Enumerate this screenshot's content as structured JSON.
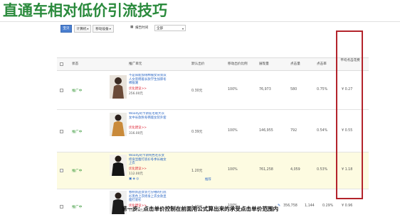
{
  "slide": {
    "title": "直通车相对低价引流技巧",
    "caption": "第一步：点击单价控制在前面用公式算出来的承受点击单价范围内"
  },
  "toolbar": {
    "tabs": [
      {
        "label": "宝贝",
        "active": true
      },
      {
        "label": "计算机",
        "active": false
      },
      {
        "label": "移动设备",
        "active": false
      }
    ],
    "report_label": "报告时间",
    "report_value": "全部"
  },
  "table": {
    "headers": {
      "status": "状态",
      "product": "推广单元",
      "default_bid": "默认出价",
      "mobile_bid": "移动出价比例",
      "impressions": "展现量",
      "clicks": "点击量",
      "ctr": "点击率",
      "avg_cpc": "平均点击花费"
    },
    "rows": [
      {
        "status": "推广中",
        "title": "不是尿能加绒棉服女背景双人女装韩版长款学生加厚冬棉服潮",
        "link": "优化建议>>",
        "price": "256.00元",
        "default_bid": "0.30元",
        "mobile_bid": "100%",
        "impressions": "76,973",
        "clicks": "580",
        "ctr": "0.75%",
        "avg_cpc": "¥ 0.27",
        "icons": "",
        "promote": "",
        "highlight": false
      },
      {
        "status": "推广中",
        "title": "Woody的卡斯驼毛呢大衣女中长款秋冬韩版女装外套",
        "link": "优化建议>>",
        "price": "316.00元",
        "default_bid": "0.39元",
        "mobile_bid": "100%",
        "impressions": "146,955",
        "clicks": "792",
        "ctr": "0.54%",
        "avg_cpc": "¥ 0.55",
        "icons": "",
        "promote": "",
        "highlight": false
      },
      {
        "status": "推广中",
        "title": "Woody的卡斯纯色毛衣女修身显瘦打底衫冬季长袖女上衣",
        "link": "优化建议>>",
        "price": "112.00元",
        "default_bid": "1.20元",
        "mobile_bid": "100%",
        "impressions": "761,258",
        "clicks": "4,059",
        "ctr": "0.53%",
        "avg_cpc": "¥ 1.18",
        "icons": "▣ ◈ ◎",
        "promote": "推荐",
        "highlight": true
      },
      {
        "status": "推广中",
        "title": "春秋新品女装七分袖的打底衫黑色上衣修身上衣女款显瘦打底衫",
        "link": "优化建议>>",
        "price": "116.00元",
        "default_bid": "1.20元",
        "mobile_bid": "100%",
        "impressions": "356,758",
        "clicks": "1,144",
        "ctr": "0.29%",
        "avg_cpc": "¥ 0.96",
        "icons": "",
        "promote": "",
        "highlight": false
      }
    ]
  },
  "colors": {
    "title_green": "#2a8a3c",
    "status_green": "#3c9a3c",
    "highlight_border": "#b3232b",
    "link_blue": "#2a66c4"
  },
  "icons": {
    "sort": "sort-icon",
    "edit": "pencil-icon",
    "dropdown": "chevron-down-icon"
  }
}
